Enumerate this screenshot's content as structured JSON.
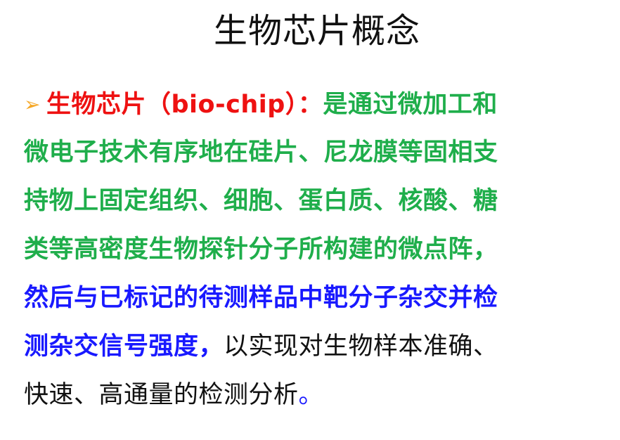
{
  "title": "生物芯片概念",
  "bullet_glyph": "➢",
  "paragraph": {
    "term": "生物芯片（bio-chip）：",
    "line1_green": "是通过微加工和",
    "line2_green": "微电子技术有序地在硅片、尼龙膜等固相支",
    "line3_green": "持物上固定组织、细胞、蛋白质、核酸、糖",
    "line4_green": "类等高密度生物探针分子所构建的微点阵，",
    "line5_blue": "然后与已标记的待测样品中靶分子杂交并检",
    "line6_blue": "测杂交信号强度，",
    "line6_black": "以实现对生物样本准确、",
    "line7_black": "快速、高通量的检测分析",
    "line7_end": "。"
  },
  "colors": {
    "term": "#ee1111",
    "green": "#1fae4b",
    "blue": "#1919ff",
    "text": "#111111",
    "bullet": "#f5a623"
  }
}
